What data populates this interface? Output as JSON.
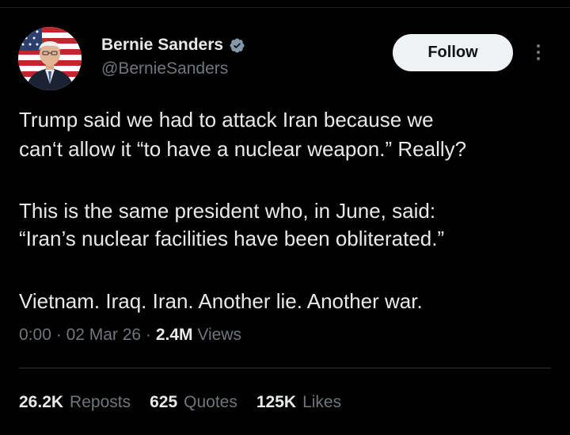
{
  "author": {
    "name": "Bernie Sanders",
    "handle": "@BernieSanders",
    "verified_icon": "verified-badge",
    "avatar_icon": "profile-photo"
  },
  "follow_label": "Follow",
  "more_icon": "more-options",
  "tweet": {
    "lines": [
      "Trump said we had to attack Iran because we",
      "can‘t allow it “to have a nuclear weapon.” Really?",
      "This is the same president who, in June, said:",
      "“Iran’s nuclear facilities have been obliterated.”",
      "Vietnam. Iraq. Iran. Another lie. Another war."
    ]
  },
  "meta": {
    "time": "0:00",
    "date": "02 Mar 26",
    "views_count": "2.4M",
    "views_label": "Views",
    "separator": "·"
  },
  "stats": {
    "reposts_count": "26.2K",
    "reposts_label": "Reposts",
    "quotes_count": "625",
    "quotes_label": "Quotes",
    "likes_count": "125K",
    "likes_label": "Likes"
  },
  "colors": {
    "background": "#000000",
    "text": "#e7e9ea",
    "secondary": "#71767b",
    "follow_bg": "#eff3f4",
    "divider": "#2f3336"
  }
}
